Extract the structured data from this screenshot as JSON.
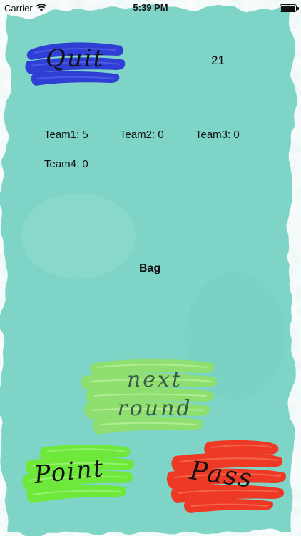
{
  "status_bar": {
    "carrier": "Carrier",
    "time": "5:39 PM"
  },
  "buttons": {
    "quit": "Quit",
    "next_round_line1": "next",
    "next_round_line2": "round",
    "point": "Point",
    "pass": "Pass"
  },
  "timer": "21",
  "scores": [
    {
      "label": "Team1: 5"
    },
    {
      "label": "Team2: 0"
    },
    {
      "label": "Team3: 0"
    },
    {
      "label": "Team4: 0"
    }
  ],
  "bag_label": "Bag",
  "colors": {
    "background": "#7fd6c8",
    "quit_paint": "#2f3fd6",
    "next_paint": "#8fe06b",
    "point_paint": "#6ee83a",
    "pass_paint": "#ee3a24"
  }
}
